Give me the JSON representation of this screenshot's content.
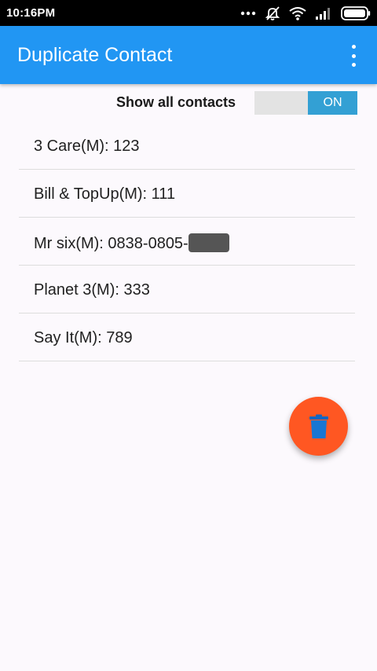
{
  "status_bar": {
    "time": "10:16PM",
    "icons": [
      "more-dots-icon",
      "silent-off-icon",
      "wifi-icon",
      "signal-icon",
      "battery-icon"
    ]
  },
  "app_bar": {
    "title": "Duplicate Contact",
    "menu_icon": "overflow-menu-icon",
    "color": "#2196f3"
  },
  "toggle": {
    "label": "Show all contacts",
    "state": "ON"
  },
  "contacts": [
    {
      "name": "3 Care(M): 123"
    },
    {
      "name": "Bill & TopUp(M): 111"
    },
    {
      "name": "Mr six(M): 0838-0805-",
      "redacted": true
    },
    {
      "name": "Planet 3(M): 333"
    },
    {
      "name": "Say It(M): 789"
    }
  ],
  "fab": {
    "icon": "trash-icon",
    "color": "#ff5722"
  }
}
